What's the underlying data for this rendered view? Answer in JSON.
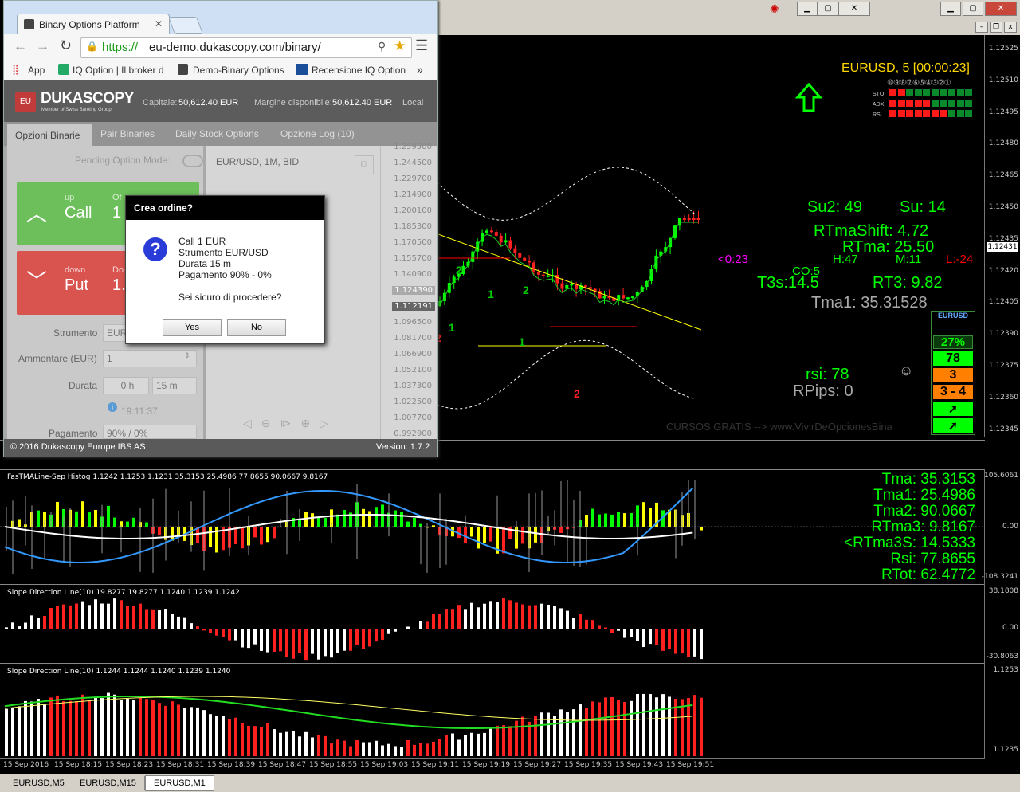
{
  "mt4": {
    "symbol_header": "EURUSD, 5 [00:00:23]",
    "price_ticks": [
      "1.12525",
      "1.12510",
      "1.12495",
      "1.12480",
      "1.12465",
      "1.12450",
      "1.12435",
      "1.12420",
      "1.12405",
      "1.12390",
      "1.12375",
      "1.12360",
      "1.12345"
    ],
    "current_price": "1.12431",
    "indicator_rows": [
      "STO",
      "ADX",
      "RSI"
    ],
    "indicator_digits": "⑩⑨⑧⑦⑥⑤④③②①",
    "stats": {
      "su2": "Su2: 49",
      "su": "Su:  14",
      "rtmashift": "RTmaShift:  4.72",
      "rtma": "RTma:  25.50",
      "h": "H:47",
      "m": "M:11",
      "l": "L:-24",
      "countdown": "<0:23",
      "co": "CO:5",
      "t3s": "T3s:14.5",
      "rt3": "RT3:  9.82",
      "tma1": "Tma1:  35.31528",
      "rsi": "rsi:  78",
      "rpips": "RPips:  0",
      "smiley": "☺"
    },
    "eurusd_box": {
      "title": "EURUSD",
      "pct": "27%",
      "v1": "78",
      "v2": "3",
      "v3": "3 - 4"
    },
    "watermark": "CURSOS GRATIS --> www.VivirDeOpcionesBina",
    "panel1": {
      "title": "FasTMALine-Sep Histog 1.1242 1.1253 1.1231 35.3153 25.4986 77.8655 90.0667 9.8167",
      "max": "105.6061",
      "zero": "0.00",
      "min": "-108.3241",
      "tma": "Tma:  35.3153",
      "tma1": "Tma1:  25.4986",
      "tma2": "Tma2: 90.0667",
      "rtma3": "RTma3: 9.8167",
      "rtma3s": "<RTma3S: 14.5333",
      "rsi": "Rsi: 77.8655",
      "rtot": "RTot: 62.4772"
    },
    "panel2": {
      "title": "Slope Direction Line(10) 19.8277 19.8277 1.1240 1.1239 1.1242",
      "max": "38.1808",
      "zero": "0.00",
      "min": "-30.8063"
    },
    "panel3": {
      "title": "Slope Direction Line(10) 1.1244 1.1244 1.1240 1.1239 1.1240",
      "max": "1.1253",
      "min": "1.1235"
    },
    "time_ticks": [
      "15 Sep 2016",
      "15 Sep 18:15",
      "15 Sep 18:23",
      "15 Sep 18:31",
      "15 Sep 18:39",
      "15 Sep 18:47",
      "15 Sep 18:55",
      "15 Sep 19:03",
      "15 Sep 19:11",
      "15 Sep 19:19",
      "15 Sep 19:27",
      "15 Sep 19:35",
      "15 Sep 19:43",
      "15 Sep 19:51"
    ],
    "tabs": [
      "EURUSD,M5",
      "EURUSD,M15",
      "EURUSD,M1"
    ],
    "active_tab": 2,
    "chart_labels": [
      "2",
      "2",
      "1",
      "1",
      "2",
      "1",
      "2"
    ]
  },
  "browser": {
    "tab_title": "Binary Options Platform",
    "url_scheme": "https://",
    "url_rest": "eu-demo.dukascopy.com/binary/",
    "bookmarks": [
      "App",
      "IQ Option | Il broker d",
      "Demo-Binary Options",
      "Recensione IQ Option"
    ],
    "more": "»"
  },
  "app": {
    "logo": "DUKASCOPY",
    "logo_sub": "Member of Swiss Banking Group",
    "capitale_label": "Capitale:",
    "capitale": "50,612.40 EUR",
    "margine_label": "Margine disponibile:",
    "margine": "50,612.40 EUR",
    "local": "Local",
    "tabs": [
      "Opzioni Binarie",
      "Pair Binaries",
      "Daily Stock Options",
      "Opzione Log (10)"
    ],
    "pending": "Pending Option Mode:",
    "call_small": "up",
    "call": "Call",
    "call_extra_small": "Of",
    "call_extra": "1",
    "put_small": "down",
    "put": "Put",
    "put_extra_small": "Do",
    "put_extra": "1.",
    "strumento_label": "Strumento",
    "strumento_val": "EUR",
    "ammontare_label": "Ammontare (EUR)",
    "ammontare_val": "1",
    "durata_label": "Durata",
    "durata_h": "0 h",
    "durata_m": "15 m",
    "time": "19:11:37",
    "pagamento_label": "Pagamento",
    "pagamento_val": "90% / 0%",
    "chart_title": "EUR/USD, 1M, BID",
    "axis": [
      "1.259500",
      "1.244500",
      "1.229700",
      "1.214900",
      "1.200100",
      "1.185300",
      "1.170500",
      "1.155700",
      "1.140900",
      "1.124390",
      "1.112191",
      "1.096500",
      "1.081700",
      "1.066900",
      "1.052100",
      "1.037300",
      "1.022500",
      "1.007700",
      "0.992900"
    ],
    "footer_left": "© 2016 Dukascopy Europe IBS AS",
    "footer_right": "Version: 1.7.2"
  },
  "dialog": {
    "title": "Crea ordine?",
    "lines": [
      "Call 1 EUR",
      "Strumento EUR/USD",
      "Durata 15 m",
      "Pagamento 90% - 0%"
    ],
    "question": "Sei sicuro di procedere?",
    "yes": "Yes",
    "no": "No"
  },
  "colors": {
    "accent_green": "#00ff00",
    "yellow": "#ffff00",
    "red": "#ff0000",
    "orange": "#ff8000",
    "magenta": "#ff00ff",
    "call_green": "#6cbf5a",
    "put_red": "#d9534f"
  }
}
